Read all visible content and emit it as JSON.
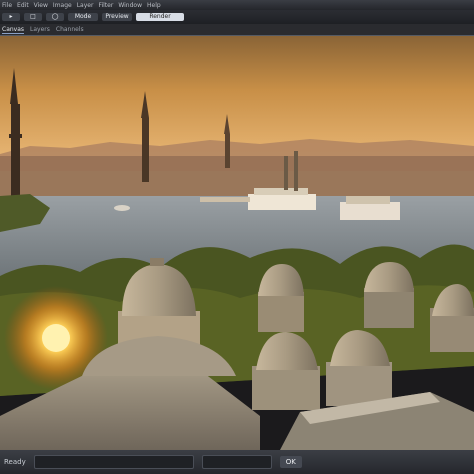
{
  "window": {
    "title_segments": [
      "File",
      "Edit",
      "View",
      "Image",
      "Layer",
      "Filter",
      "Window",
      "Help"
    ]
  },
  "toolbar": {
    "tools": [
      "▸",
      "□",
      "◯",
      "Mode",
      "Preview",
      "Render"
    ],
    "active_index": 5
  },
  "tabs": {
    "items": [
      "Canvas",
      "Layers",
      "Channels"
    ],
    "active_index": 0
  },
  "canvas": {
    "description_colors": {
      "sky_top": "#7a5a33",
      "sky_mid": "#c98f48",
      "sky_horizon": "#e9b56a",
      "water": "#8a8f95",
      "sun": "#ffcf5a",
      "dome": "#b3a48d",
      "foliage": "#4d5a23"
    }
  },
  "status": {
    "left_label": "Ready",
    "field_one": "",
    "field_two": "",
    "button_label": "OK"
  }
}
